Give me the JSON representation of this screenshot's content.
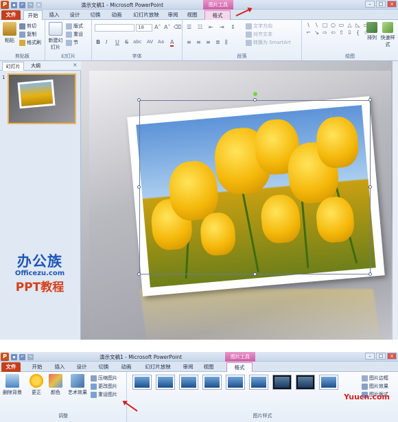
{
  "top": {
    "window_title": "演示文稿1 - Microsoft PowerPoint",
    "context_header": "图片工具",
    "tabs": [
      "文件",
      "开始",
      "插入",
      "设计",
      "切换",
      "动画",
      "幻灯片放映",
      "审阅",
      "视图",
      "格式"
    ],
    "active_tab": "开始",
    "clipboard": {
      "paste": "粘贴",
      "cut": "剪切",
      "copy": "复制",
      "format_painter": "格式刷",
      "label": "剪贴板"
    },
    "slides": {
      "new_slide": "新建幻灯片",
      "layout": "版式",
      "reset": "重设",
      "section": "节",
      "label": "幻灯片"
    },
    "font": {
      "size": "18",
      "label": "字体",
      "btns": [
        "B",
        "I",
        "U",
        "S",
        "abc",
        "AV",
        "Aa",
        "A"
      ]
    },
    "paragraph": {
      "label": "段落",
      "text_direction": "文字方向",
      "align_text": "对齐文本",
      "smartart": "转换为 SmartArt"
    },
    "drawing": {
      "arrange": "排列",
      "quick_styles": "快速样式",
      "label": "绘图"
    },
    "side_tabs": [
      "幻灯片",
      "大纲"
    ],
    "slide_number": "1",
    "logo": {
      "line1": "办公族",
      "line2": "Officezu.com",
      "line3": "PPT教程"
    }
  },
  "bottom": {
    "window_title": "演示文稿1 - Microsoft PowerPoint",
    "context_header": "图片工具",
    "tabs": [
      "文件",
      "开始",
      "插入",
      "设计",
      "切换",
      "动画",
      "幻灯片放映",
      "审阅",
      "视图",
      "格式"
    ],
    "active_tab": "格式",
    "adjust": {
      "remove_bg": "删除背景",
      "corrections": "更正",
      "color": "颜色",
      "artistic": "艺术效果",
      "compress": "压缩图片",
      "change": "更改图片",
      "reset": "重设图片",
      "label": "调整"
    },
    "picture_styles": {
      "label": "图片样式",
      "border": "图片边框",
      "effects": "图片效果",
      "layout": "图片版式"
    },
    "watermark": "Yuucn.com"
  },
  "colors": {
    "file_tab": "#c43e1c",
    "context": "#cc5fa6",
    "arrow": "#d32020",
    "logo_blue": "#1f56b5",
    "logo_red": "#d6401d"
  }
}
